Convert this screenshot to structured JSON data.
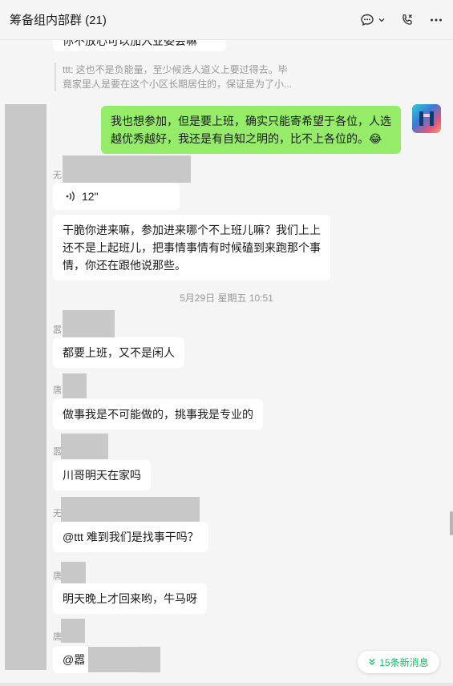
{
  "header": {
    "title": "筹备组内部群 (21)",
    "icons": [
      "chat-bubble-icon",
      "chevron-down-icon",
      "phone-call-icon",
      "more-icon"
    ]
  },
  "messages": {
    "top_partial": "你不放心可以加入业委会嘛",
    "quote_text": "ttt: 这也不是负能量，至少候选人道义上要过得去。毕竟家里人是要在这个小区长期居住的，保证是为了小...",
    "me_msg": "我也想参加，但是要上班，确实只能寄希望于各位，人选越优秀越好，我还是有自知之明的，比不上各位的。😂",
    "voice_duration": "12\"",
    "msg_long": "干脆你进来嘛，参加进来哪个不上班儿嘛？我们上上还不是上起班儿，把事情事情有时候磕到来跑那个事情，你还在跟他说那些。",
    "time_divider": "5月29日 星期五 10:51",
    "msg_busy": "都要上班，又不是闲人",
    "msg_pro": "做事我是不可能做的，挑事我是专业的",
    "msg_home": "川哥明天在家吗",
    "msg_at": "@ttt 难到我们是找事干吗？",
    "msg_tomorrow": "明天晚上才回来哟，牛马呀",
    "msg_at_partial": "@嚣"
  },
  "names": {
    "n1": "无",
    "n2": "嚣",
    "n3": "唐",
    "n4": "嚣",
    "n5": "无",
    "n6": "唐",
    "n7": "唐"
  },
  "new_messages_label": "15条新消息",
  "colors": {
    "my_bubble": "#95ec69",
    "accent": "#07c160"
  }
}
